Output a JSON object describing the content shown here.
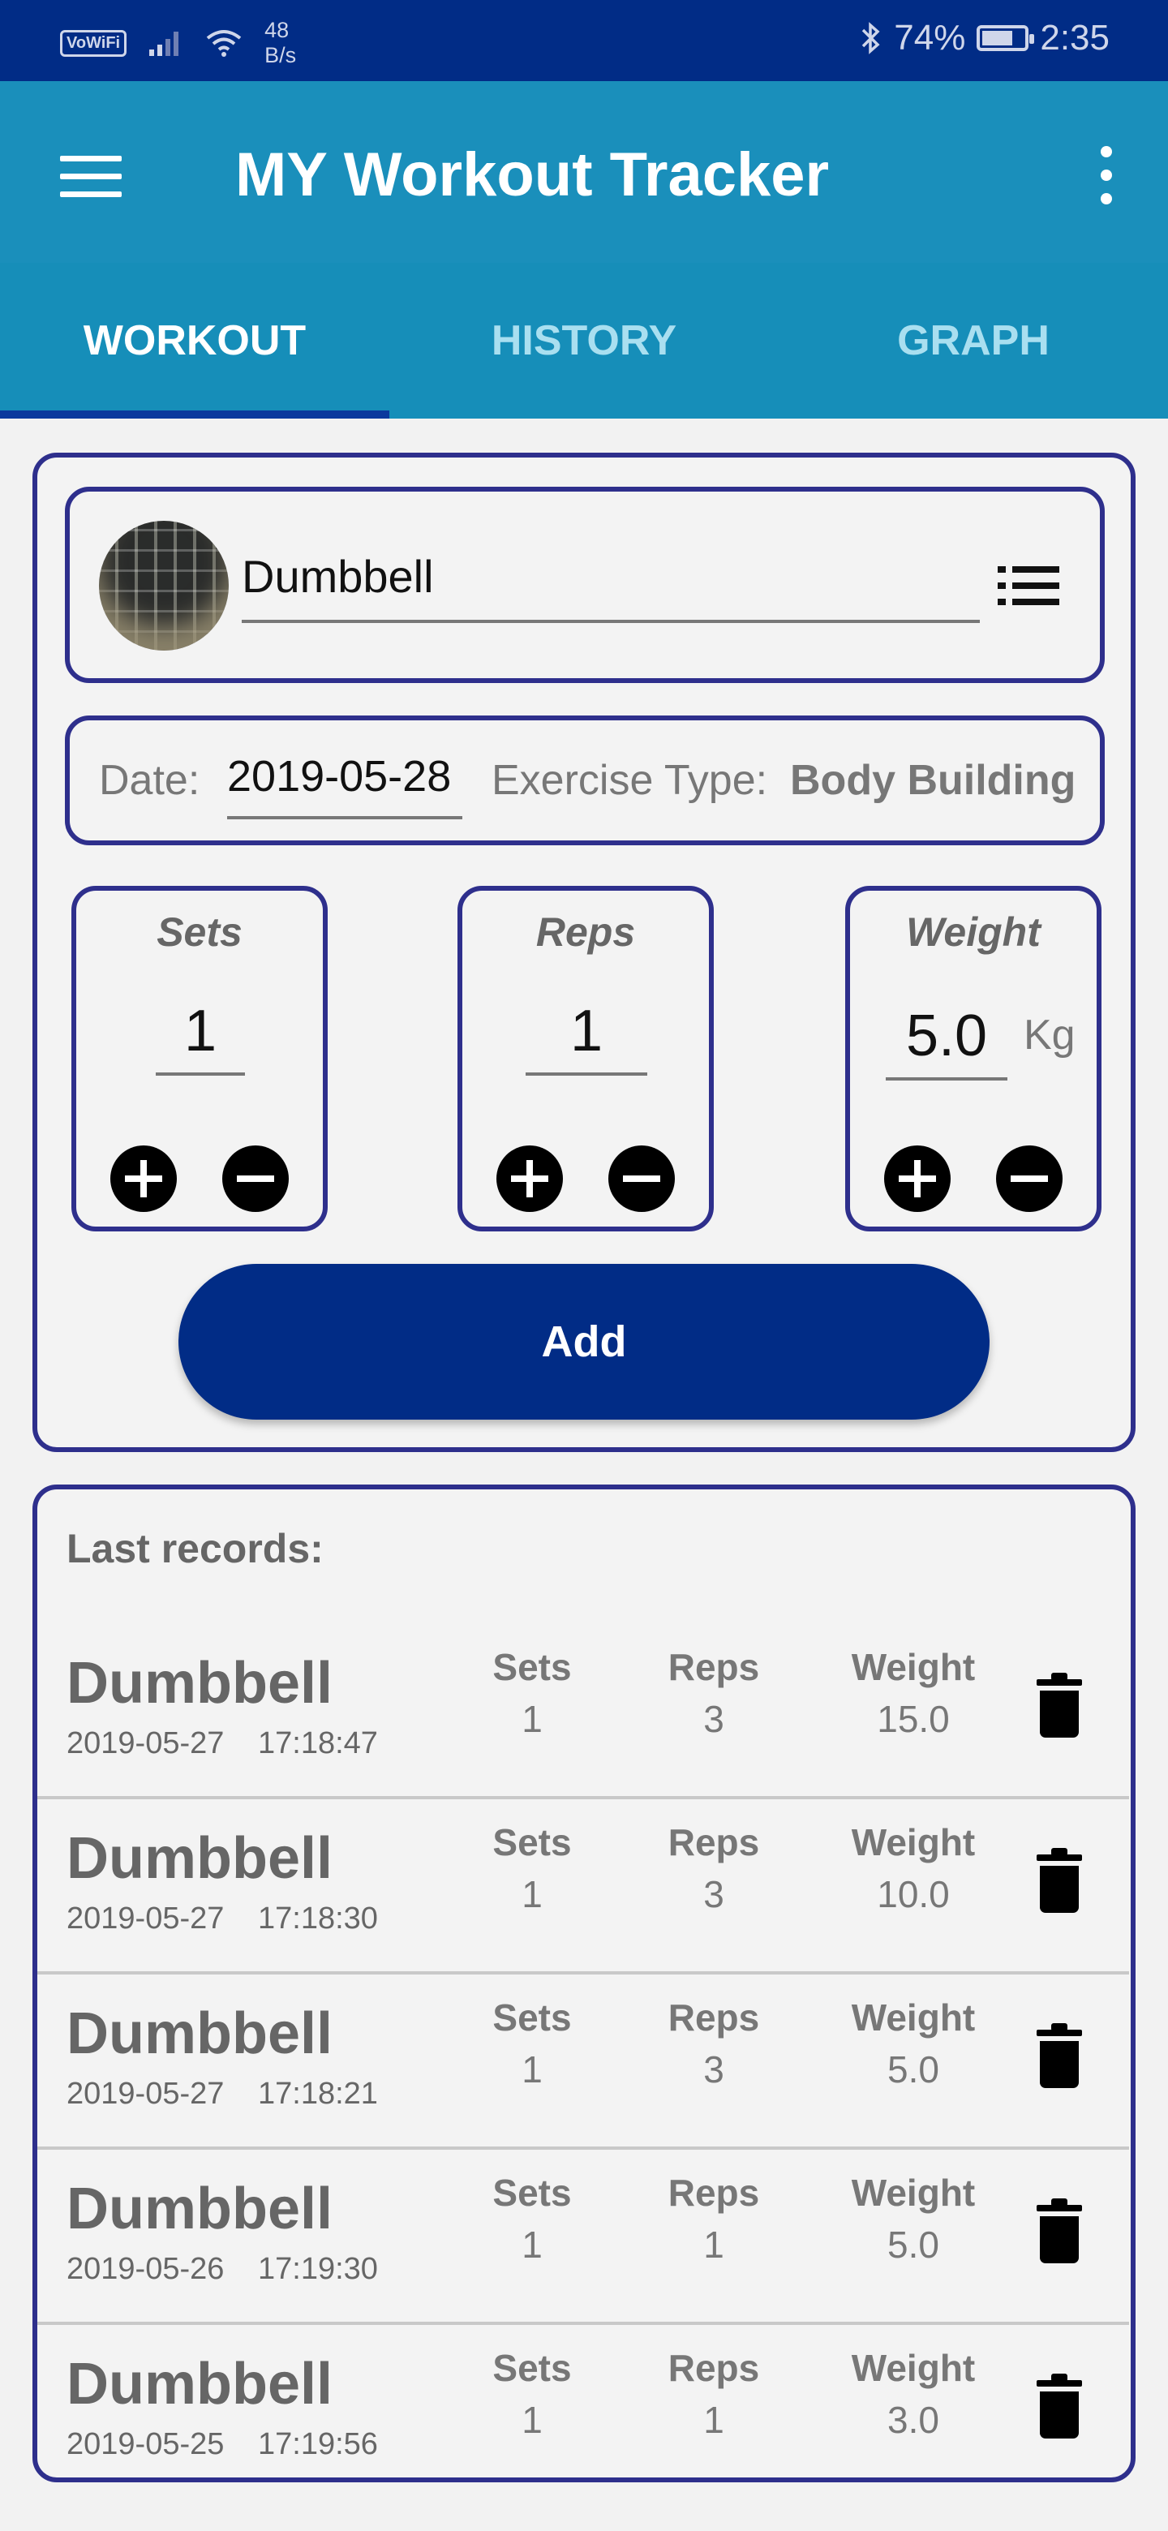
{
  "status_bar": {
    "vowifi": "VoWiFi",
    "speed_value": "48",
    "speed_unit": "B/s",
    "battery": "74%",
    "time": "2:35",
    "battery_level": 0.74
  },
  "app_bar": {
    "title": "MY Workout Tracker"
  },
  "tabs": [
    {
      "label": "WORKOUT",
      "active": true
    },
    {
      "label": "HISTORY",
      "active": false
    },
    {
      "label": "GRAPH",
      "active": false
    }
  ],
  "exercise": {
    "name": "Dumbbell"
  },
  "details": {
    "date_label": "Date:",
    "date_value": "2019-05-28",
    "type_label": "Exercise Type:",
    "type_value": "Body Building"
  },
  "counters": {
    "sets": {
      "label": "Sets",
      "value": "1"
    },
    "reps": {
      "label": "Reps",
      "value": "1"
    },
    "weight": {
      "label": "Weight",
      "value": "5.0",
      "unit": "Kg"
    }
  },
  "add_button": "Add",
  "records": {
    "title": "Last records:",
    "headers": {
      "sets": "Sets",
      "reps": "Reps",
      "weight": "Weight"
    },
    "rows": [
      {
        "name": "Dumbbell",
        "date": "2019-05-27",
        "time": "17:18:47",
        "sets": "1",
        "reps": "3",
        "weight": "15.0"
      },
      {
        "name": "Dumbbell",
        "date": "2019-05-27",
        "time": "17:18:30",
        "sets": "1",
        "reps": "3",
        "weight": "10.0"
      },
      {
        "name": "Dumbbell",
        "date": "2019-05-27",
        "time": "17:18:21",
        "sets": "1",
        "reps": "3",
        "weight": "5.0"
      },
      {
        "name": "Dumbbell",
        "date": "2019-05-26",
        "time": "17:19:30",
        "sets": "1",
        "reps": "1",
        "weight": "5.0"
      },
      {
        "name": "Dumbbell",
        "date": "2019-05-25",
        "time": "17:19:56",
        "sets": "1",
        "reps": "1",
        "weight": "3.0"
      }
    ]
  },
  "colors": {
    "status_bar": "#012c86",
    "app_bar": "#1a8fbb",
    "card_border": "#2e2f8c",
    "add_button": "#012c86"
  }
}
